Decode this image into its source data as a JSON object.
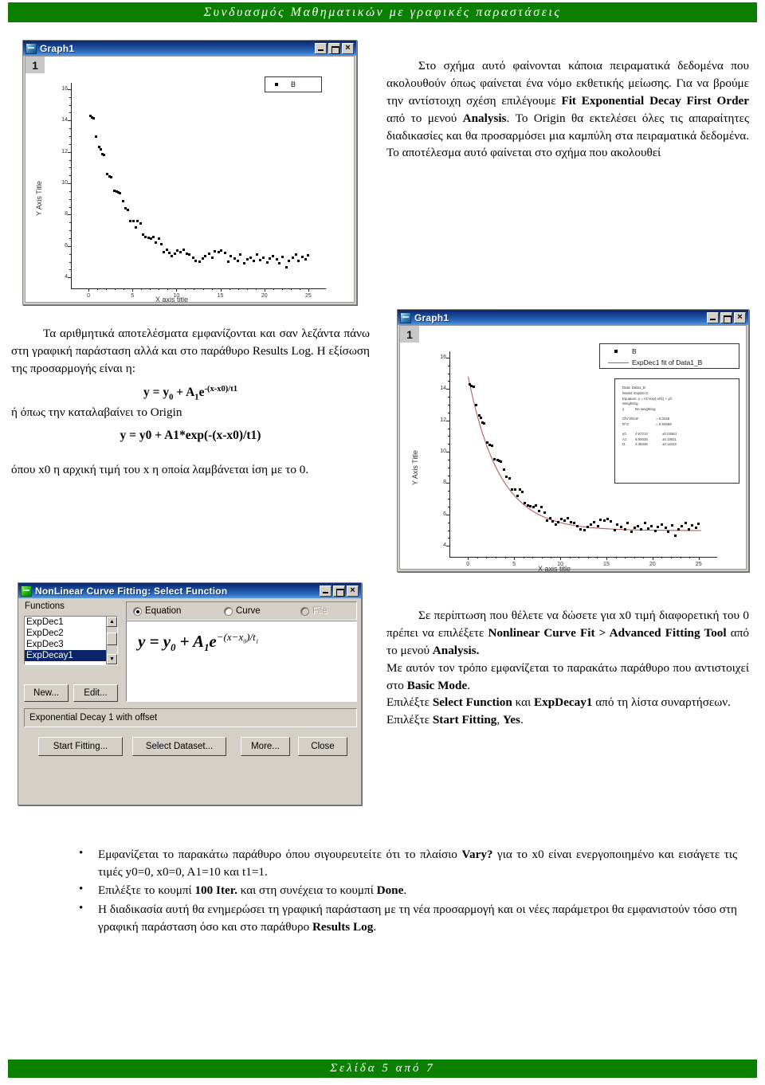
{
  "header": {
    "title": "Συνδυασμός Μαθηματικών με γραφικές παραστάσεις"
  },
  "footer": {
    "text": "Σελίδα 5 από 7"
  },
  "colors": {
    "banner_green": "#0b8000",
    "titlebar_blue": "#0a246a",
    "dialog_face": "#d4d0c8",
    "fit_curve": "#b55c5c",
    "marker": "#000000",
    "selection": "#0a246a"
  },
  "graph1": {
    "title": "Graph1",
    "layer_badge": "1",
    "legend": [
      {
        "label": "B",
        "symbol": "square"
      }
    ],
    "x_axis": {
      "title": "X axis title",
      "ticks": [
        "0",
        "5",
        "10",
        "15",
        "20",
        "25"
      ],
      "min": -2,
      "max": 27
    },
    "y_axis": {
      "title": "Y Axis Title",
      "ticks": [
        "16",
        "14",
        "12",
        "10",
        "8",
        "6",
        "4"
      ],
      "min": 3.3,
      "max": 16.4
    },
    "buttons": {
      "minimize": "_",
      "maximize": "□",
      "close": "×"
    }
  },
  "graph2": {
    "title": "Graph1",
    "layer_badge": "1",
    "legend": [
      {
        "label": "B",
        "symbol": "square"
      },
      {
        "label": "ExpDec1 fit of Data1_B",
        "symbol": "line"
      }
    ],
    "x_axis": {
      "title": "X axis title",
      "ticks": [
        "0",
        "5",
        "10",
        "15",
        "20",
        "25"
      ],
      "min": -2,
      "max": 27
    },
    "y_axis": {
      "title": "Y Axis Title",
      "ticks": [
        "16",
        "14",
        "12",
        "10",
        "8",
        "6",
        "4"
      ],
      "min": 3.3,
      "max": 16.4
    },
    "buttons": {
      "minimize": "_",
      "maximize": "□",
      "close": "×"
    },
    "stats": {
      "data": "Data: Data1_B",
      "model": "Model: ExpDec1",
      "equation": "Equation: y = A1*exp(-x/t1) + y0",
      "weighting_label": "Weighting:",
      "weighting_value_key": "y",
      "weighting_value": "No weighting",
      "chi2_label": "Chi^2/DoF",
      "chi2_value": "= 0.0325",
      "r2_label": "R^2",
      "r2_value": "= 0.93599",
      "params": [
        {
          "name": "y0",
          "value": "4.97214",
          "error": "±0.04561"
        },
        {
          "name": "A1",
          "value": "9.90025",
          "error": "±0.15511"
        },
        {
          "name": "t1",
          "value": "3.38445",
          "error": "±0.11022"
        }
      ]
    }
  },
  "dialog": {
    "title": "NonLinear Curve Fitting: Select Function",
    "buttons": {
      "minimize": "_",
      "maximize": "□",
      "close": "×"
    },
    "functions_label": "Functions",
    "functions": [
      "ExpDec1",
      "ExpDec2",
      "ExpDec3",
      "ExpDecay1"
    ],
    "selected_function": "ExpDecay1",
    "scroll_up": "▲",
    "scroll_down": "▼",
    "new_button": "New...",
    "edit_button": "Edit...",
    "radios": [
      {
        "label": "Equation",
        "selected": true,
        "disabled": false
      },
      {
        "label": "Curve",
        "selected": false,
        "disabled": false
      },
      {
        "label": "File",
        "selected": false,
        "disabled": true
      }
    ],
    "equation_display": "y = y₀ + A₁e^-(x-x₀)/t₁",
    "description": "Exponential Decay 1 with offset",
    "action_buttons": [
      "Start Fitting...",
      "Select Dataset...",
      "More...",
      "Close"
    ]
  },
  "text_blocks": {
    "intro": {
      "p1_a": "Στο σχήμα αυτό φαίνονται κάποια πειραματικά δεδομένα που ακολουθούν όπως φαίνεται ένα νόμο εκθετικής μείωσης. Για να βρούμε την αντίστοιχη σχέση επιλέγουμε ",
      "p1_b": "Fit Exponential Decay First Order",
      "p1_c": " από το μενού ",
      "p1_d": "Analysis",
      "p1_e": ". Το Origin θα εκτελέσει όλες τις απαραίτητες διαδικασίες και θα προσαρμόσει μια καμπύλη στα πειραματικά δεδομένα. Το αποτέλεσμα αυτό φαίνεται στο σχήμα που ακολουθεί"
    },
    "results": {
      "p1": "Τα αριθμητικά αποτελέσματα εμφανίζονται και σαν λεζάντα πάνω στη γραφική παράσταση αλλά και στο παράθυρο Results Log. Η εξίσωση της προσαρμογής είναι η:",
      "eq1_html": "y = y0 + A1e-(x-x0)/t1",
      "mid": "ή όπως την καταλαβαίνει το Origin",
      "eq2": "y = y0 + A1*exp(-(x-x0)/t1)",
      "p2": "όπου x0 η αρχική τιμή του x η οποία λαμβάνεται ίση με το 0."
    },
    "advanced": {
      "a1": "Σε περίπτωση που θέλετε να δώσετε για x0 τιμή διαφορετική του 0 πρέπει να επιλέξετε ",
      "a2": "Nonlinear Curve Fit > Advanced Fitting Tool",
      "a3": " από το μενού ",
      "a4": "Analysis.",
      "b1": "Με αυτόν τον τρόπο εμφανίζεται το παρακάτω παράθυρο που αντιστοιχεί στο ",
      "b2": "Basic Mode",
      "b3": ".",
      "c1": "Επιλέξτε ",
      "c2": "Select Function",
      "c3": " και ",
      "c4": "ExpDecay1",
      "c5": " από τη λίστα συναρτήσεων.",
      "d1": "Επιλέξτε ",
      "d2": "Start Fitting",
      "d3": ", ",
      "d4": "Yes",
      "d5": "."
    }
  },
  "bullets": [
    {
      "parts": [
        {
          "t": "Εμφανίζεται το παρακάτω παράθυρο όπου σιγουρευτείτε ότι το πλαίσιο ",
          "b": false
        },
        {
          "t": "Vary?",
          "b": true
        },
        {
          "t": " για το x0 είναι ενεργοποιημένο και εισάγετε τις τιμές y0=0, x0=0, A1=10 και t1=1.",
          "b": false
        }
      ]
    },
    {
      "parts": [
        {
          "t": "Επιλέξτε το κουμπί ",
          "b": false
        },
        {
          "t": "100 Iter.",
          "b": true
        },
        {
          "t": " και στη συνέχεια το κουμπί ",
          "b": false
        },
        {
          "t": "Done",
          "b": true
        },
        {
          "t": ".",
          "b": false
        }
      ]
    },
    {
      "parts": [
        {
          "t": "Η διαδικασία αυτή θα ενημερώσει τη γραφική παράσταση με τη νέα προσαρμογή και οι νέες παράμετροι θα εμφανιστούν τόσο στη γραφική παράσταση όσο και στο παράθυρο ",
          "b": false
        },
        {
          "t": "Results Log",
          "b": true
        },
        {
          "t": ".",
          "b": false
        }
      ]
    }
  ],
  "chart_data": [
    {
      "type": "scatter",
      "title": "Graph1",
      "xlabel": "X axis title",
      "ylabel": "Y Axis Title",
      "xlim": [
        -2,
        27
      ],
      "ylim": [
        3.3,
        16.4
      ],
      "xticks": [
        0,
        5,
        10,
        15,
        20,
        25
      ],
      "yticks": [
        4,
        6,
        8,
        10,
        12,
        14,
        16
      ],
      "grid": false,
      "legend": [
        "B"
      ],
      "legend_position": "top-right",
      "series": [
        {
          "name": "B",
          "x": [
            0.2,
            0.4,
            0.6,
            0.9,
            1.2,
            1.4,
            1.6,
            1.8,
            2.1,
            2.4,
            2.6,
            2.9,
            3.2,
            3.4,
            3.6,
            3.9,
            4.2,
            4.5,
            4.8,
            5.1,
            5.4,
            5.6,
            5.9,
            6.2,
            6.5,
            6.8,
            7.1,
            7.4,
            7.7,
            8.0,
            8.3,
            8.6,
            8.9,
            9.2,
            9.5,
            9.8,
            10.1,
            10.5,
            10.8,
            11.2,
            11.5,
            11.9,
            12.2,
            12.6,
            13.0,
            13.3,
            13.7,
            14.1,
            14.4,
            14.8,
            15.1,
            15.5,
            15.9,
            16.2,
            16.6,
            17.0,
            17.3,
            17.7,
            18.1,
            18.4,
            18.8,
            19.2,
            19.5,
            19.9,
            20.3,
            20.6,
            21.0,
            21.4,
            21.7,
            22.1,
            22.5,
            22.8,
            23.2,
            23.6,
            23.9,
            24.3,
            24.7,
            25.0
          ],
          "y": [
            14.3,
            14.2,
            14.15,
            12.95,
            12.3,
            12.15,
            11.85,
            11.8,
            10.6,
            10.45,
            10.4,
            9.5,
            9.45,
            9.4,
            9.35,
            8.85,
            8.4,
            8.3,
            7.6,
            7.6,
            7.2,
            7.6,
            7.45,
            6.7,
            6.55,
            6.5,
            6.45,
            6.55,
            6.2,
            6.45,
            6.1,
            5.6,
            5.75,
            5.55,
            5.35,
            5.5,
            5.7,
            5.6,
            5.75,
            5.5,
            5.45,
            5.25,
            5.05,
            5.0,
            5.2,
            5.35,
            5.5,
            5.25,
            5.65,
            5.6,
            5.7,
            5.55,
            5.0,
            5.35,
            5.2,
            5.05,
            5.45,
            4.9,
            5.15,
            5.25,
            5.05,
            5.45,
            5.1,
            5.25,
            4.95,
            5.2,
            5.35,
            5.15,
            4.9,
            5.3,
            4.65,
            5.05,
            5.25,
            5.45,
            5.05,
            5.3,
            5.15,
            5.4
          ]
        }
      ]
    },
    {
      "type": "scatter",
      "title": "Graph1",
      "xlabel": "X axis title",
      "ylabel": "Y Axis Title",
      "xlim": [
        -2,
        27
      ],
      "ylim": [
        3.3,
        16.4
      ],
      "xticks": [
        0,
        5,
        10,
        15,
        20,
        25
      ],
      "yticks": [
        4,
        6,
        8,
        10,
        12,
        14,
        16
      ],
      "grid": false,
      "legend": [
        "B",
        "ExpDec1 fit of Data1_B"
      ],
      "legend_position": "top-right",
      "fit": {
        "model": "ExpDec1",
        "equation": "y = A1*exp(-x/t1) + y0",
        "y0": 4.97214,
        "A1": 9.90025,
        "t1": 3.38445,
        "chi2_dof": 0.0325,
        "r2": 0.93599
      },
      "series": [
        {
          "name": "B",
          "x": [
            0.2,
            0.4,
            0.6,
            0.9,
            1.2,
            1.4,
            1.6,
            1.8,
            2.1,
            2.4,
            2.6,
            2.9,
            3.2,
            3.4,
            3.6,
            3.9,
            4.2,
            4.5,
            4.8,
            5.1,
            5.4,
            5.6,
            5.9,
            6.2,
            6.5,
            6.8,
            7.1,
            7.4,
            7.7,
            8.0,
            8.3,
            8.6,
            8.9,
            9.2,
            9.5,
            9.8,
            10.1,
            10.5,
            10.8,
            11.2,
            11.5,
            11.9,
            12.2,
            12.6,
            13.0,
            13.3,
            13.7,
            14.1,
            14.4,
            14.8,
            15.1,
            15.5,
            15.9,
            16.2,
            16.6,
            17.0,
            17.3,
            17.7,
            18.1,
            18.4,
            18.8,
            19.2,
            19.5,
            19.9,
            20.3,
            20.6,
            21.0,
            21.4,
            21.7,
            22.1,
            22.5,
            22.8,
            23.2,
            23.6,
            23.9,
            24.3,
            24.7,
            25.0
          ],
          "y": [
            14.3,
            14.2,
            14.15,
            12.95,
            12.3,
            12.15,
            11.85,
            11.8,
            10.6,
            10.45,
            10.4,
            9.5,
            9.45,
            9.4,
            9.35,
            8.85,
            8.4,
            8.3,
            7.6,
            7.6,
            7.2,
            7.6,
            7.45,
            6.7,
            6.55,
            6.5,
            6.45,
            6.55,
            6.2,
            6.45,
            6.1,
            5.6,
            5.75,
            5.55,
            5.35,
            5.5,
            5.7,
            5.6,
            5.75,
            5.5,
            5.45,
            5.25,
            5.05,
            5.0,
            5.2,
            5.35,
            5.5,
            5.25,
            5.65,
            5.6,
            5.7,
            5.55,
            5.0,
            5.35,
            5.2,
            5.05,
            5.45,
            4.9,
            5.15,
            5.25,
            5.05,
            5.45,
            5.1,
            5.25,
            4.95,
            5.2,
            5.35,
            5.15,
            4.9,
            5.3,
            4.65,
            5.05,
            5.25,
            5.45,
            5.05,
            5.3,
            5.15,
            5.4
          ]
        }
      ]
    }
  ]
}
